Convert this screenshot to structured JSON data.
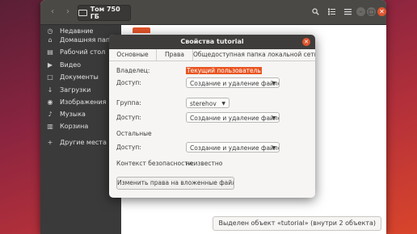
{
  "file_manager": {
    "location": "Том 750 ГБ",
    "sidebar": {
      "items": [
        {
          "label": "Недавние",
          "icon": "clock-icon"
        },
        {
          "label": "Домашняя папка",
          "icon": "home-icon"
        },
        {
          "label": "Рабочий стол",
          "icon": "desktop-icon"
        },
        {
          "label": "Видео",
          "icon": "video-icon"
        },
        {
          "label": "Документы",
          "icon": "document-icon"
        },
        {
          "label": "Загрузки",
          "icon": "download-icon"
        },
        {
          "label": "Изображения",
          "icon": "camera-icon"
        },
        {
          "label": "Музыка",
          "icon": "music-icon"
        },
        {
          "label": "Корзина",
          "icon": "trash-icon"
        },
        {
          "label": "Другие места",
          "icon": "plus-icon"
        }
      ]
    },
    "status": "Выделен объект «tutorial» (внутри 2 объекта)"
  },
  "dialog": {
    "title": "Свойства tutorial",
    "tabs": [
      "Основные",
      "Права",
      "Общедоступная папка локальной сети"
    ],
    "owner_label": "Владелец:",
    "owner_value": "Текущий пользователь",
    "owner_access_label": "Доступ:",
    "owner_access_value": "Создание и удаление файлов",
    "group_label": "Группа:",
    "group_value": "sterehov",
    "group_access_label": "Доступ:",
    "group_access_value": "Создание и удаление файлов",
    "others_heading": "Остальные",
    "others_access_label": "Доступ:",
    "others_access_value": "Создание и удаление файлов",
    "security_label": "Контекст безопасности:",
    "security_value": "неизвестно",
    "apply_button": "Изменить права на вложенные файлы..."
  },
  "colors": {
    "accent": "#e95420",
    "headerbar": "#4b4946",
    "sidebar": "#3a3a3a"
  }
}
